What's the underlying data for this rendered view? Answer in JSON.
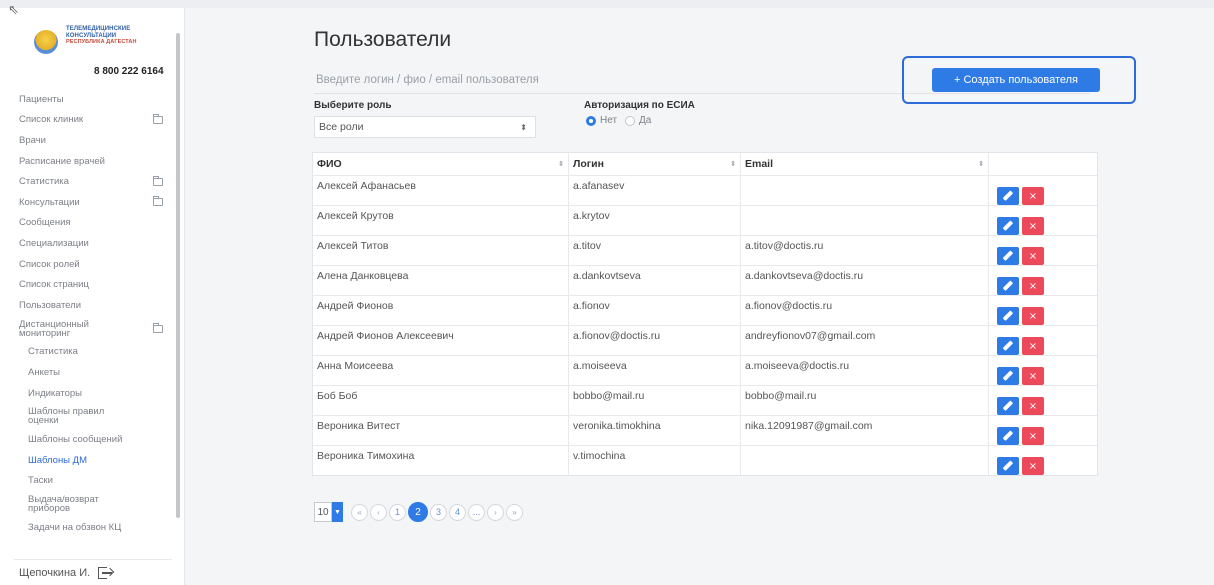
{
  "sidebar": {
    "logo": {
      "line1": "ТЕЛЕМЕДИЦИНСКИЕ",
      "line2": "КОНСУЛЬТАЦИИ",
      "line3": "РЕСПУБЛИКА ДАГЕСТАН"
    },
    "phone": "8 800 222 6164",
    "items": [
      {
        "label": "Пациенты",
        "folder": false
      },
      {
        "label": "Список клиник",
        "folder": true
      },
      {
        "label": "Врачи",
        "folder": false
      },
      {
        "label": "Расписание врачей",
        "folder": false
      },
      {
        "label": "Статистика",
        "folder": true
      },
      {
        "label": "Консультации",
        "folder": true
      },
      {
        "label": "Сообщения",
        "folder": false
      },
      {
        "label": "Специализации",
        "folder": false
      },
      {
        "label": "Список ролей",
        "folder": false
      },
      {
        "label": "Список страниц",
        "folder": false
      },
      {
        "label": "Пользователи",
        "folder": false
      },
      {
        "label": "Дистанционный мониторинг",
        "folder": true
      }
    ],
    "subitems": [
      {
        "label": "Статистика"
      },
      {
        "label": "Анкеты"
      },
      {
        "label": "Индикаторы"
      },
      {
        "label": "Шаблоны правил оценки"
      },
      {
        "label": "Шаблоны сообщений"
      },
      {
        "label": "Шаблоны ДМ"
      },
      {
        "label": "Таски"
      },
      {
        "label": "Выдача/возврат приборов"
      },
      {
        "label": "Задачи на обзвон КЦ"
      }
    ],
    "user_name": "Щепочкина И."
  },
  "main": {
    "title": "Пользователи",
    "search_placeholder": "Введите логин / фио / email пользователя",
    "create_button": "+ Создать пользователя",
    "role_filter": {
      "label": "Выберите роль",
      "value": "Все роли"
    },
    "esia": {
      "label": "Авторизация по ЕСИА",
      "option_no": "Нет",
      "option_yes": "Да",
      "selected": "Нет"
    },
    "table": {
      "headers": [
        "ФИО",
        "Логин",
        "Email"
      ],
      "rows": [
        {
          "fio": "Алексей Афанасьев",
          "login": "a.afanasev",
          "email": ""
        },
        {
          "fio": "Алексей Крутов",
          "login": "a.krytov",
          "email": ""
        },
        {
          "fio": "Алексей Титов",
          "login": "a.titov",
          "email": "a.titov@doctis.ru"
        },
        {
          "fio": "Алена Данковцева",
          "login": "a.dankovtseva",
          "email": "a.dankovtseva@doctis.ru"
        },
        {
          "fio": "Андрей Фионов",
          "login": "a.fionov",
          "email": "a.fionov@doctis.ru"
        },
        {
          "fio": "Андрей Фионов Алексеевич",
          "login": "a.fionov@doctis.ru",
          "email": "andreyfionov07@gmail.com"
        },
        {
          "fio": "Анна Моисеева",
          "login": "a.moiseeva",
          "email": "a.moiseeva@doctis.ru"
        },
        {
          "fio": "Боб Боб",
          "login": "bobbo@mail.ru",
          "email": "bobbo@mail.ru"
        },
        {
          "fio": "Вероника Витест",
          "login": "veronika.timokhina",
          "email": "nika.12091987@gmail.com"
        },
        {
          "fio": "Вероника Тимохина",
          "login": "v.timochina",
          "email": ""
        }
      ],
      "delete_glyph": "×"
    },
    "pagination": {
      "page_size": "10",
      "first": "«",
      "prev": "‹",
      "pages": [
        "1",
        "2",
        "3",
        "4",
        "..."
      ],
      "current": "2",
      "next": "›",
      "last": "»"
    }
  }
}
